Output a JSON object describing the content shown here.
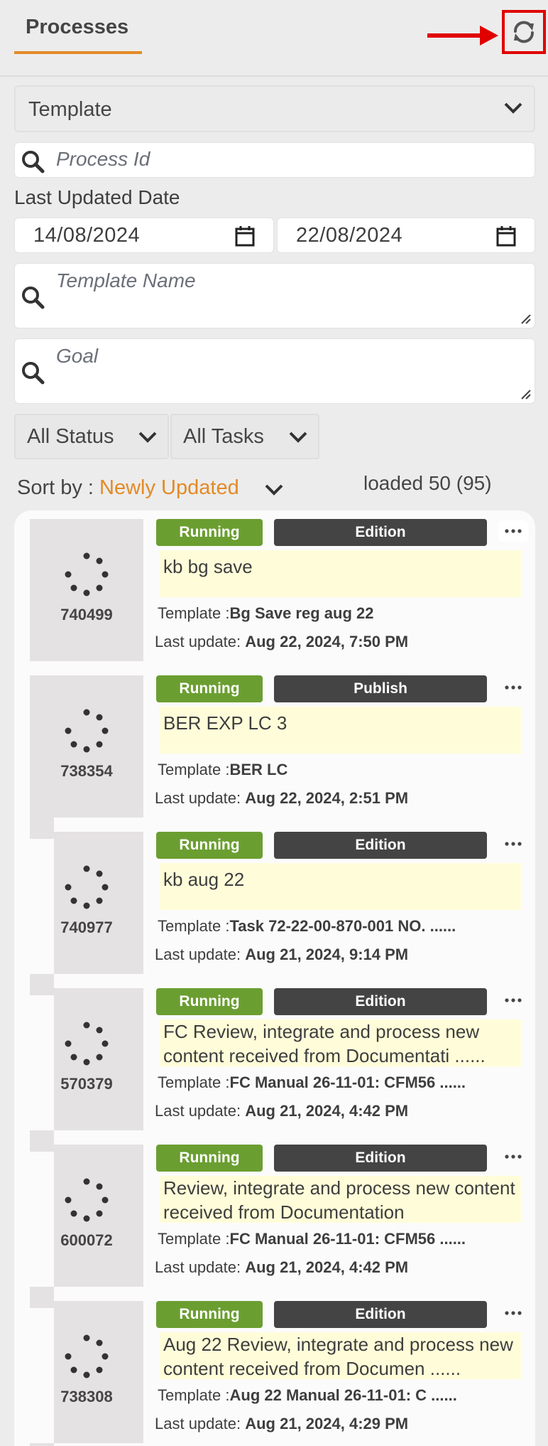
{
  "header": {
    "tab_label": "Processes"
  },
  "filters": {
    "template_label": "Template",
    "process_id_placeholder": "Process Id",
    "last_updated_label": "Last Updated Date",
    "date_from": "14/08/2024",
    "date_to": "22/08/2024",
    "template_name_placeholder": "Template Name",
    "goal_placeholder": "Goal",
    "status_label": "All Status",
    "tasks_label": "All Tasks"
  },
  "sort": {
    "prefix": "Sort by : ",
    "value": "Newly Updated"
  },
  "loaded_text": "loaded 50 (95)",
  "labels": {
    "template_prefix": "Template :",
    "last_update_prefix": "Last update: "
  },
  "processes": [
    {
      "id": "740499",
      "status": "Running",
      "mode": "Edition",
      "goal": "kb bg save",
      "template": "Bg Save reg aug 22",
      "last_update": "Aug 22, 2024, 7:50 PM"
    },
    {
      "id": "738354",
      "status": "Running",
      "mode": "Publish",
      "goal": "BER EXP LC 3",
      "template": "BER LC",
      "last_update": "Aug 22, 2024, 2:51 PM"
    },
    {
      "id": "740977",
      "status": "Running",
      "mode": "Edition",
      "goal": "kb aug 22",
      "template": "Task 72-22-00-870-001 NO. ......",
      "last_update": "Aug 21, 2024, 9:14 PM"
    },
    {
      "id": "570379",
      "status": "Running",
      "mode": "Edition",
      "goal": "FC Review, integrate and process new content received from Documentati ......",
      "template": "FC Manual 26-11-01: CFM56 ......",
      "last_update": "Aug 21, 2024, 4:42 PM"
    },
    {
      "id": "600072",
      "status": "Running",
      "mode": "Edition",
      "goal": "Review, integrate and process new content received from Documentation",
      "template": "FC Manual 26-11-01: CFM56 ......",
      "last_update": "Aug 21, 2024, 4:42 PM"
    },
    {
      "id": "738308",
      "status": "Running",
      "mode": "Edition",
      "goal": "Aug 22 Review, integrate and process new content received from Documen ......",
      "template": "Aug 22 Manual 26-11-01: C ......",
      "last_update": "Aug 21, 2024, 4:29 PM"
    }
  ],
  "colors": {
    "accent": "#e38a25",
    "running": "#6b9e31",
    "mode": "#444444",
    "goal_bg": "#fffdd9",
    "annotation": "#e10000"
  },
  "icons": {
    "refresh": "refresh-icon",
    "search": "search-icon",
    "calendar": "calendar-icon",
    "chevron": "chevron-down-icon",
    "more": "more-horizontal-icon",
    "spinner": "spinner-icon"
  }
}
